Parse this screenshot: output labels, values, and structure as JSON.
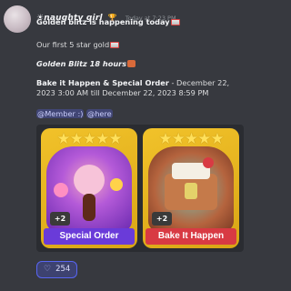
{
  "author": {
    "name": "☀naughty girl",
    "badge_icon": "trophy-icon",
    "timestamp": "Today at 7:23 PM"
  },
  "message": {
    "line1": "Golden blitz is happening today",
    "line2": "Our first 5 star gold",
    "line3": "Golden Blitz 18 hours",
    "line4_bold": "Bake it Happen & Special Order",
    "line4_rest": " - December 22, 2023 3:00 AM till December 22, 2023 8:59 PM",
    "mention1": "@Member :)",
    "mention2": "@here"
  },
  "cards": [
    {
      "banner": "Special Order",
      "plus": "+2",
      "stars": "★★★★★",
      "color": "#6a3bd9"
    },
    {
      "banner": "Bake It Happen",
      "plus": "+2",
      "stars": "★★★★★",
      "color": "#d83a43"
    }
  ],
  "reaction": {
    "icon": "heart-icon",
    "count": "254"
  }
}
